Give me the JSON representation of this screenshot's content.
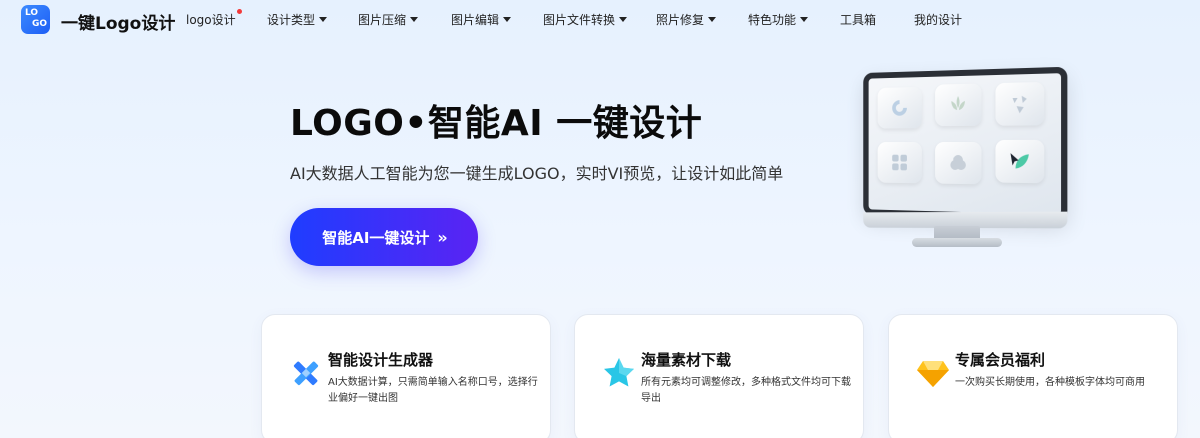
{
  "nav": {
    "logo_text": [
      "LO",
      "GO"
    ],
    "brand": "一键Logo设计",
    "items": [
      {
        "label": "logo设计",
        "dropdown": false,
        "badge_dot": true
      },
      {
        "label": "设计类型",
        "dropdown": true
      },
      {
        "label": "图片压缩",
        "dropdown": true
      },
      {
        "label": "图片编辑",
        "dropdown": true
      },
      {
        "label": "图片文件转换",
        "dropdown": true
      },
      {
        "label": "照片修复",
        "dropdown": true
      },
      {
        "label": "特色功能",
        "dropdown": true
      },
      {
        "label": "工具箱",
        "dropdown": false
      },
      {
        "label": "我的设计",
        "dropdown": false
      }
    ]
  },
  "hero": {
    "title": "LOGO•智能AI 一键设计",
    "subtitle": "AI大数据人工智能为您一键生成LOGO，实时VI预览，让设计如此简单",
    "cta_label": "智能AI一键设计",
    "cta_arrows": "»"
  },
  "features": [
    {
      "title": "智能设计生成器",
      "desc": "AI大数据计算，只需简单输入名称口号，选择行业偏好一键出图",
      "icon": "pencil-ruler-icon"
    },
    {
      "title": "海量素材下载",
      "desc": "所有元素均可调整修改，多种格式文件均可下载导出",
      "icon": "star-icon"
    },
    {
      "title": "专属会员福利",
      "desc": "一次购买长期使用，各种模板字体均可商用",
      "icon": "diamond-icon"
    }
  ],
  "colors": {
    "accent_blue": "#1f3dff",
    "accent_purple": "#5a23f3",
    "badge_red": "#f23a3a",
    "logo_blue": "#2b6ef6"
  }
}
